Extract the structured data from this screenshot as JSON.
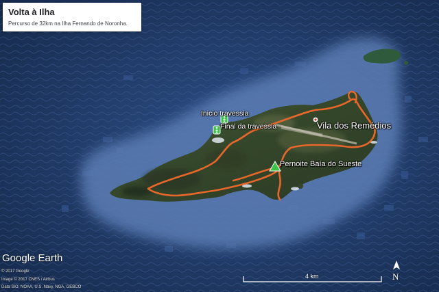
{
  "info": {
    "title": "Volta à Ilha",
    "subtitle": "Percurso de 32km na Ilha Fernando de Noronha."
  },
  "places": {
    "inicio": "Inicio travessia",
    "final": "Final da travessia",
    "vila": "Vila dos Remédios",
    "pernoite": "Pernoite Baía do Sueste"
  },
  "branding": {
    "logo_text": "Google Earth",
    "credit_1": "© 2017 Google",
    "credit_2": "Image © 2017 CNES / Airbus",
    "credit_3": "Data SIO, NOAA, U.S. Navy, NGA, GEBCO"
  },
  "scale": {
    "label": "4 km"
  },
  "compass": {
    "letter": "N"
  },
  "colors": {
    "ocean": "#1d3a66",
    "shelf": "#5a7bb0",
    "land": "#3d4a2e",
    "route": "#e8672a",
    "marker_green": "#3cc24a"
  },
  "icons": {
    "trail_marker": "hiker-marker-icon",
    "camp_marker": "tent-marker-icon",
    "town_marker": "place-pin-icon",
    "compass": "north-arrow-icon"
  }
}
